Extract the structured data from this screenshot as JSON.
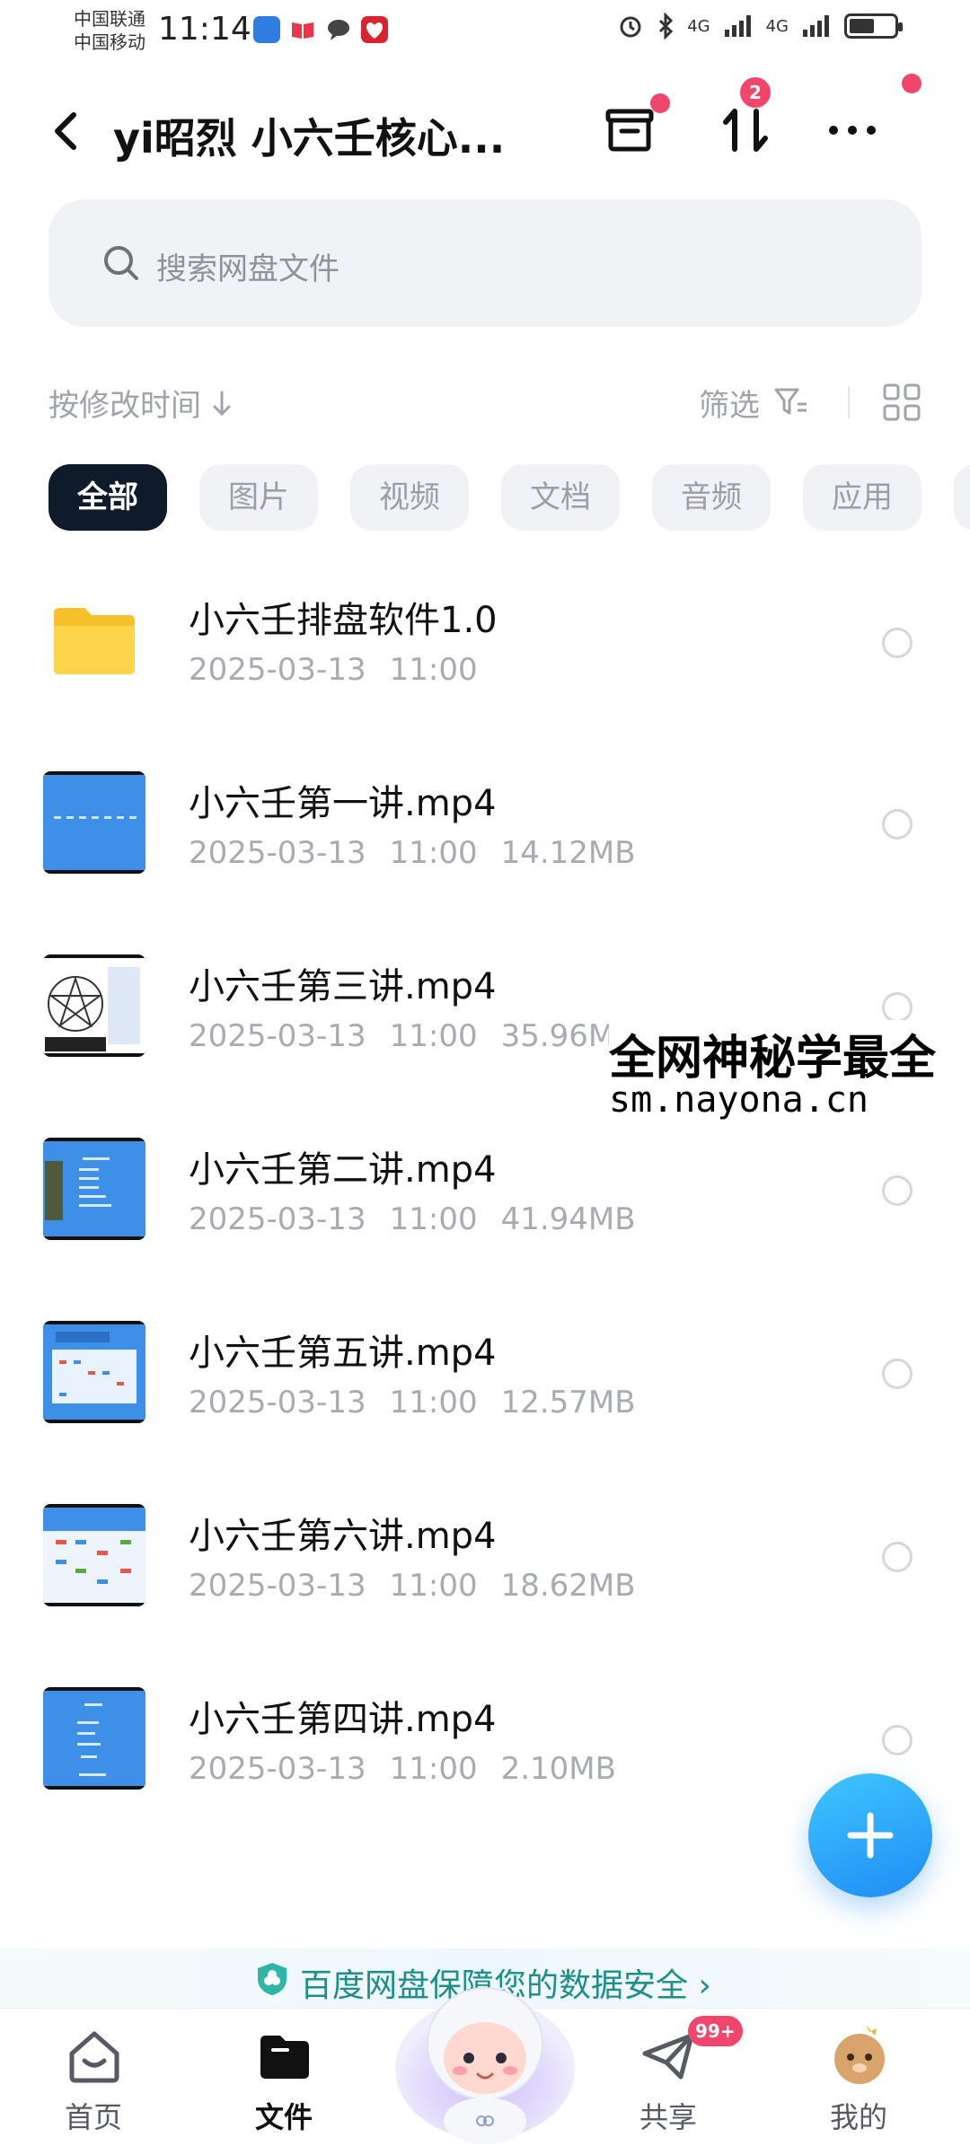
{
  "status_bar": {
    "carrier_1": "中国联通",
    "carrier_2": "中国移动",
    "time": "11:14",
    "signal_1": "4G",
    "signal_2": "4G"
  },
  "header": {
    "title": "yi昭烈 小六壬核心...",
    "transfer_badge": "2"
  },
  "search": {
    "placeholder": "搜索网盘文件"
  },
  "toolbar": {
    "sort_label": "按修改时间",
    "filter_label": "筛选"
  },
  "chips": [
    "全部",
    "图片",
    "视频",
    "文档",
    "音频",
    "应用"
  ],
  "files": [
    {
      "name": "小六壬排盘软件1.0",
      "date": "2025-03-13",
      "time": "11:00",
      "size": ""
    },
    {
      "name": "小六壬第一讲.mp4",
      "date": "2025-03-13",
      "time": "11:00",
      "size": "14.12MB"
    },
    {
      "name": "小六壬第三讲.mp4",
      "date": "2025-03-13",
      "time": "11:00",
      "size": "35.96MB"
    },
    {
      "name": "小六壬第二讲.mp4",
      "date": "2025-03-13",
      "time": "11:00",
      "size": "41.94MB"
    },
    {
      "name": "小六壬第五讲.mp4",
      "date": "2025-03-13",
      "time": "11:00",
      "size": "12.57MB"
    },
    {
      "name": "小六壬第六讲.mp4",
      "date": "2025-03-13",
      "time": "11:00",
      "size": "18.62MB"
    },
    {
      "name": "小六壬第四讲.mp4",
      "date": "2025-03-13",
      "time": "11:00",
      "size": "2.10MB"
    }
  ],
  "watermark": {
    "line1": "全网神秘学最全",
    "line2": "sm.nayona.cn"
  },
  "banner": {
    "text": "百度网盘保障您的数据安全 ›"
  },
  "tabs": [
    {
      "label": "首页"
    },
    {
      "label": "文件"
    },
    {
      "label": "共享",
      "badge": "99+"
    },
    {
      "label": "我的"
    }
  ],
  "colors": {
    "accent": "#1f8cf5",
    "badge": "#f1456b",
    "active_chip": "#0f1b2b",
    "banner_text": "#1c8f8a"
  }
}
